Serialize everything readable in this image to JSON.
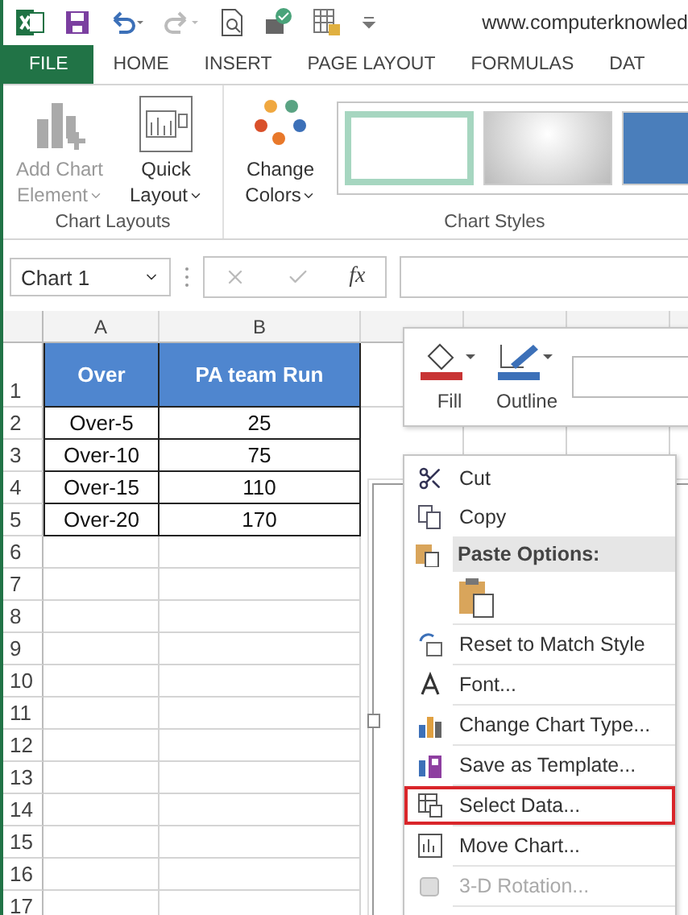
{
  "title_bar": {
    "title": "www.computerknowled"
  },
  "ribbon_tabs": [
    {
      "label": "FILE",
      "kind": "file"
    },
    {
      "label": "HOME",
      "kind": "tab"
    },
    {
      "label": "INSERT",
      "kind": "tab"
    },
    {
      "label": "PAGE LAYOUT",
      "kind": "tab"
    },
    {
      "label": "FORMULAS",
      "kind": "tab"
    },
    {
      "label": "DAT",
      "kind": "tab"
    }
  ],
  "ribbon_groups": [
    {
      "label": "Chart Layouts",
      "buttons": [
        {
          "lines": [
            "Add Chart",
            "Element"
          ],
          "disabled": true
        },
        {
          "lines": [
            "Quick",
            "Layout"
          ],
          "disabled": false
        }
      ]
    },
    {
      "label": "Chart Styles",
      "buttons": [
        {
          "lines": [
            "Change",
            "Colors"
          ],
          "disabled": false
        }
      ],
      "styles": [
        {
          "kind": "outline",
          "selected": true
        },
        {
          "kind": "gradient",
          "selected": false
        },
        {
          "kind": "fill",
          "selected": false
        }
      ]
    }
  ],
  "formula_bar": {
    "name_box": "Chart 1",
    "function_label": "fx"
  },
  "sheet": {
    "columns": [
      "A",
      "B"
    ],
    "rows": [
      {
        "number": "1",
        "kind": "header",
        "cells": [
          "Over",
          "PA team Run"
        ]
      },
      {
        "number": "2",
        "kind": "data",
        "cells": [
          "Over-5",
          "25"
        ]
      },
      {
        "number": "3",
        "kind": "data",
        "cells": [
          "Over-10",
          "75"
        ]
      },
      {
        "number": "4",
        "kind": "data",
        "cells": [
          "Over-15",
          "110"
        ]
      },
      {
        "number": "5",
        "kind": "data",
        "cells": [
          "Over-20",
          "170"
        ]
      },
      {
        "number": "6",
        "kind": "empty"
      },
      {
        "number": "7",
        "kind": "empty"
      },
      {
        "number": "8",
        "kind": "empty"
      },
      {
        "number": "9",
        "kind": "empty"
      },
      {
        "number": "10",
        "kind": "empty"
      },
      {
        "number": "11",
        "kind": "empty"
      },
      {
        "number": "12",
        "kind": "empty"
      },
      {
        "number": "13",
        "kind": "empty"
      },
      {
        "number": "14",
        "kind": "empty"
      },
      {
        "number": "15",
        "kind": "empty"
      },
      {
        "number": "16",
        "kind": "empty"
      },
      {
        "number": "17",
        "kind": "empty"
      }
    ]
  },
  "mini_toolbar": {
    "buttons": [
      {
        "label": "Fill",
        "kind": "fill"
      },
      {
        "label": "Outline",
        "kind": "outline"
      }
    ]
  },
  "context_menu": {
    "items": [
      {
        "kind": "item",
        "label": "Cut",
        "disabled": false,
        "highlighted": false
      },
      {
        "kind": "item",
        "label": "Copy",
        "disabled": false,
        "highlighted": false
      },
      {
        "kind": "header",
        "label": "Paste Options:"
      },
      {
        "kind": "paste_row"
      },
      {
        "kind": "item",
        "label": "Reset to Match Style",
        "disabled": false,
        "highlighted": false
      },
      {
        "kind": "item",
        "label": "Font...",
        "disabled": false,
        "highlighted": false
      },
      {
        "kind": "item",
        "label": "Change Chart Type...",
        "disabled": false,
        "highlighted": false
      },
      {
        "kind": "item",
        "label": "Save as Template...",
        "disabled": false,
        "highlighted": false
      },
      {
        "kind": "item",
        "label": "Select Data...",
        "disabled": false,
        "highlighted": true
      },
      {
        "kind": "item",
        "label": "Move Chart...",
        "disabled": false,
        "highlighted": false
      },
      {
        "kind": "item",
        "label": "3-D Rotation...",
        "disabled": true,
        "highlighted": false
      }
    ]
  }
}
